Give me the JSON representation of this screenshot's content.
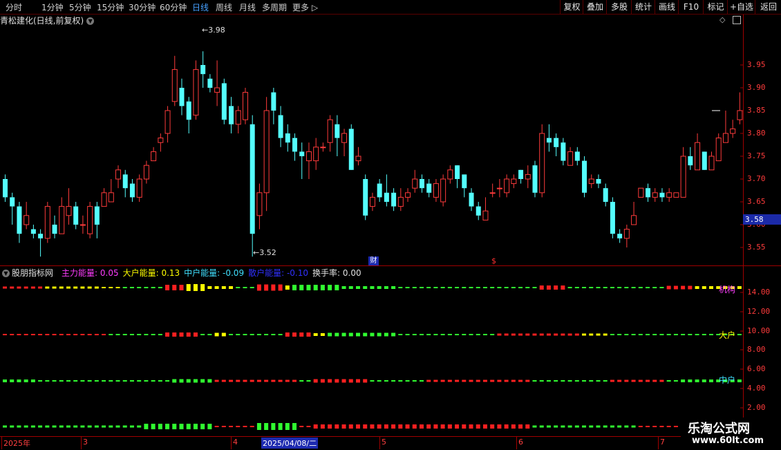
{
  "toolbar": {
    "periods": [
      "分时",
      "1分钟",
      "5分钟",
      "15分钟",
      "30分钟",
      "60分钟",
      "日线",
      "周线",
      "月线",
      "多周期",
      "更多"
    ],
    "active_period": "日线",
    "buttons": [
      "复权",
      "叠加",
      "多股",
      "统计",
      "画线",
      "F10",
      "标记",
      "+自选",
      "返回"
    ]
  },
  "chart_header": {
    "title": "青松建化(日线,前复权)"
  },
  "price_axis": {
    "labels": [
      "3.95",
      "3.90",
      "3.85",
      "3.80",
      "3.75",
      "3.70",
      "3.65",
      "3.60",
      "3.55"
    ],
    "current_price": "3.58"
  },
  "annotations": {
    "high": "3.98",
    "low": "3.52",
    "marker_cai": "财",
    "marker_s": "$"
  },
  "indicator": {
    "name": "股朋指标网",
    "items": [
      {
        "label": "主力能量: 0.05",
        "color": "#ff3cff"
      },
      {
        "label": "大户能量: 0.13",
        "color": "#ffff00"
      },
      {
        "label": "中户能量: -0.09",
        "color": "#40e0ff"
      },
      {
        "label": "散户能量: -0.10",
        "color": "#3030ff"
      },
      {
        "label": "换手率: 0.00",
        "color": "#e0e0e0"
      }
    ],
    "row_labels": [
      {
        "text": "机构",
        "color": "#ff40ff"
      },
      {
        "text": "大户",
        "color": "#ffff00"
      },
      {
        "text": "中户",
        "color": "#40e0ff"
      }
    ],
    "axis_labels": [
      "14.00",
      "12.00",
      "10.00",
      "8.00",
      "6.00",
      "4.00",
      "2.00"
    ]
  },
  "date_axis": {
    "labels": [
      "2025年",
      "3",
      "4",
      "5",
      "6",
      "7"
    ],
    "selected": "2025/04/08/二"
  },
  "watermark": {
    "line1": "乐淘公式网",
    "line2": "www.60lt.com"
  },
  "chart_data": {
    "type": "candlestick",
    "ylim": [
      3.5,
      4.0
    ],
    "y_ticks": [
      3.55,
      3.6,
      3.65,
      3.7,
      3.75,
      3.8,
      3.85,
      3.9,
      3.95
    ],
    "high_label": 3.98,
    "low_label": 3.52,
    "candles": [
      [
        3.7,
        3.66,
        3.71,
        3.65
      ],
      [
        3.66,
        3.64,
        3.67,
        3.6
      ],
      [
        3.64,
        3.58,
        3.65,
        3.56
      ],
      [
        3.6,
        3.62,
        3.65,
        3.59
      ],
      [
        3.59,
        3.58,
        3.6,
        3.57
      ],
      [
        3.58,
        3.57,
        3.59,
        3.53
      ],
      [
        3.57,
        3.64,
        3.65,
        3.56
      ],
      [
        3.6,
        3.58,
        3.62,
        3.57
      ],
      [
        3.58,
        3.64,
        3.66,
        3.58
      ],
      [
        3.62,
        3.64,
        3.68,
        3.6
      ],
      [
        3.64,
        3.6,
        3.65,
        3.59
      ],
      [
        3.6,
        3.6,
        3.62,
        3.58
      ],
      [
        3.58,
        3.64,
        3.65,
        3.57
      ],
      [
        3.64,
        3.6,
        3.65,
        3.57
      ],
      [
        3.64,
        3.67,
        3.68,
        3.64
      ],
      [
        3.65,
        3.67,
        3.7,
        3.65
      ],
      [
        3.7,
        3.72,
        3.73,
        3.68
      ],
      [
        3.71,
        3.68,
        3.72,
        3.66
      ],
      [
        3.69,
        3.66,
        3.7,
        3.65
      ],
      [
        3.66,
        3.7,
        3.71,
        3.65
      ],
      [
        3.7,
        3.73,
        3.74,
        3.69
      ],
      [
        3.74,
        3.76,
        3.77,
        3.74
      ],
      [
        3.78,
        3.79,
        3.8,
        3.76
      ],
      [
        3.8,
        3.85,
        3.86,
        3.78
      ],
      [
        3.87,
        3.94,
        3.97,
        3.86
      ],
      [
        3.9,
        3.86,
        3.92,
        3.84
      ],
      [
        3.87,
        3.83,
        3.88,
        3.8
      ],
      [
        3.84,
        3.94,
        3.96,
        3.83
      ],
      [
        3.95,
        3.93,
        3.98,
        3.9
      ],
      [
        3.92,
        3.9,
        3.93,
        3.89
      ],
      [
        3.89,
        3.9,
        3.96,
        3.86
      ],
      [
        3.91,
        3.83,
        3.92,
        3.82
      ],
      [
        3.86,
        3.82,
        3.88,
        3.8
      ],
      [
        3.82,
        3.85,
        3.86,
        3.8
      ],
      [
        3.83,
        3.89,
        3.9,
        3.82
      ],
      [
        3.82,
        3.58,
        3.84,
        3.53
      ],
      [
        3.62,
        3.67,
        3.69,
        3.59
      ],
      [
        3.67,
        3.85,
        3.88,
        3.63
      ],
      [
        3.89,
        3.85,
        3.9,
        3.82
      ],
      [
        3.84,
        3.79,
        3.86,
        3.77
      ],
      [
        3.8,
        3.78,
        3.82,
        3.76
      ],
      [
        3.79,
        3.76,
        3.8,
        3.74
      ],
      [
        3.76,
        3.75,
        3.78,
        3.7
      ],
      [
        3.74,
        3.76,
        3.78,
        3.7
      ],
      [
        3.74,
        3.77,
        3.79,
        3.72
      ],
      [
        3.77,
        3.77,
        3.78,
        3.76
      ],
      [
        3.78,
        3.83,
        3.84,
        3.76
      ],
      [
        3.82,
        3.79,
        3.84,
        3.75
      ],
      [
        3.78,
        3.8,
        3.81,
        3.75
      ],
      [
        3.81,
        3.72,
        3.82,
        3.72
      ],
      [
        3.74,
        3.75,
        3.77,
        3.73
      ],
      [
        3.7,
        3.62,
        3.71,
        3.61
      ],
      [
        3.64,
        3.66,
        3.67,
        3.63
      ],
      [
        3.69,
        3.66,
        3.7,
        3.65
      ],
      [
        3.67,
        3.65,
        3.71,
        3.64
      ],
      [
        3.67,
        3.64,
        3.68,
        3.63
      ],
      [
        3.64,
        3.66,
        3.68,
        3.63
      ],
      [
        3.66,
        3.67,
        3.68,
        3.65
      ],
      [
        3.68,
        3.7,
        3.72,
        3.67
      ],
      [
        3.7,
        3.68,
        3.71,
        3.67
      ],
      [
        3.69,
        3.67,
        3.7,
        3.66
      ],
      [
        3.66,
        3.69,
        3.7,
        3.65
      ],
      [
        3.65,
        3.7,
        3.71,
        3.64
      ],
      [
        3.7,
        3.72,
        3.73,
        3.69
      ],
      [
        3.73,
        3.7,
        3.73,
        3.68
      ],
      [
        3.71,
        3.68,
        3.71,
        3.66
      ],
      [
        3.67,
        3.64,
        3.68,
        3.63
      ],
      [
        3.64,
        3.62,
        3.65,
        3.61
      ],
      [
        3.61,
        3.63,
        3.66,
        3.61
      ],
      [
        3.67,
        3.67,
        3.69,
        3.66
      ],
      [
        3.68,
        3.68,
        3.7,
        3.66
      ],
      [
        3.67,
        3.7,
        3.71,
        3.66
      ],
      [
        3.69,
        3.7,
        3.71,
        3.68
      ],
      [
        3.72,
        3.7,
        3.72,
        3.69
      ],
      [
        3.7,
        3.71,
        3.73,
        3.68
      ],
      [
        3.73,
        3.67,
        3.74,
        3.66
      ],
      [
        3.67,
        3.8,
        3.82,
        3.66
      ],
      [
        3.79,
        3.78,
        3.82,
        3.76
      ],
      [
        3.79,
        3.77,
        3.8,
        3.75
      ],
      [
        3.78,
        3.74,
        3.79,
        3.73
      ],
      [
        3.73,
        3.76,
        3.77,
        3.73
      ],
      [
        3.76,
        3.74,
        3.77,
        3.73
      ],
      [
        3.74,
        3.67,
        3.75,
        3.66
      ],
      [
        3.69,
        3.7,
        3.71,
        3.68
      ],
      [
        3.7,
        3.69,
        3.71,
        3.68
      ],
      [
        3.68,
        3.65,
        3.69,
        3.64
      ],
      [
        3.65,
        3.58,
        3.66,
        3.57
      ],
      [
        3.58,
        3.57,
        3.59,
        3.56
      ],
      [
        3.57,
        3.59,
        3.6,
        3.55
      ],
      [
        3.6,
        3.62,
        3.65,
        3.6
      ],
      [
        3.66,
        3.68,
        3.68,
        3.66
      ],
      [
        3.68,
        3.66,
        3.69,
        3.65
      ],
      [
        3.66,
        3.67,
        3.68,
        3.65
      ],
      [
        3.67,
        3.66,
        3.68,
        3.65
      ],
      [
        3.66,
        3.67,
        3.68,
        3.65
      ],
      [
        3.66,
        3.67,
        3.67,
        3.66
      ],
      [
        3.66,
        3.75,
        3.77,
        3.66
      ],
      [
        3.75,
        3.73,
        3.77,
        3.72
      ],
      [
        3.72,
        3.78,
        3.8,
        3.72
      ],
      [
        3.76,
        3.72,
        3.76,
        3.72
      ],
      [
        3.72,
        3.75,
        3.76,
        3.72
      ],
      [
        3.74,
        3.79,
        3.8,
        3.74
      ],
      [
        3.78,
        3.8,
        3.85,
        3.78
      ],
      [
        3.8,
        3.81,
        3.83,
        3.79
      ],
      [
        3.83,
        3.85,
        3.89,
        3.82
      ]
    ]
  }
}
